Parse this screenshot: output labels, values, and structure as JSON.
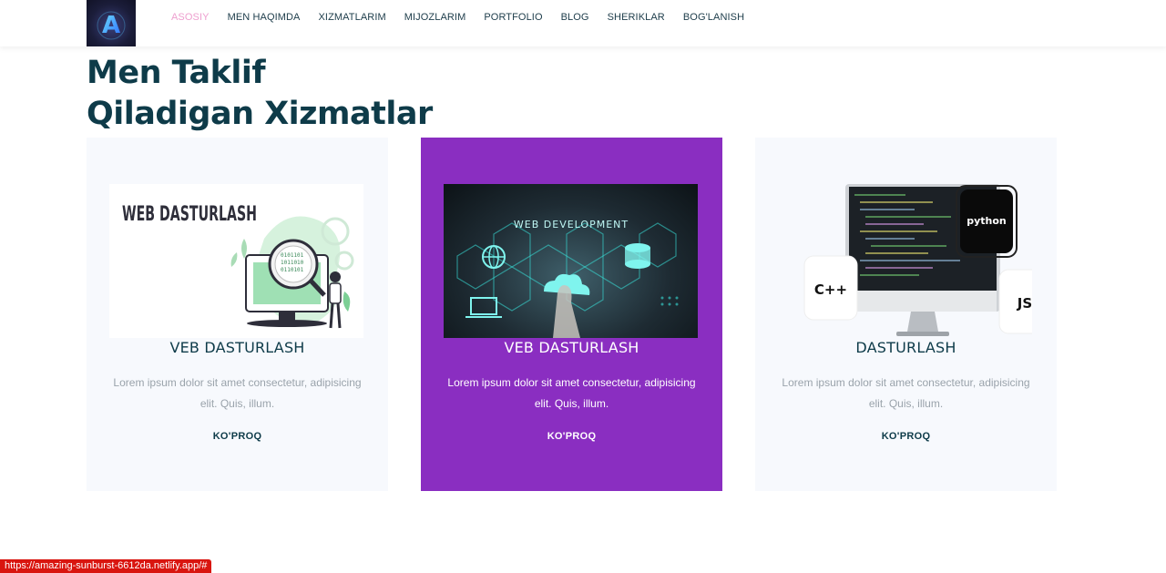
{
  "nav": {
    "logo_letter": "A",
    "links": [
      "ASOSIY",
      "MEN HAQIMDA",
      "XIZMATLARIM",
      "MIJOZLARIM",
      "PORTFOLIO",
      "BLOG",
      "SHERIKLAR",
      "BOG'LANISH"
    ],
    "active_link": "ASOSIY"
  },
  "section": {
    "title_line1": "Men Taklif",
    "title_line2": "Qiladigan Xizmatlar"
  },
  "cards": [
    {
      "title": "VEB DASTURLASH",
      "image_text": "WEB DASTURLASH",
      "description": "Lorem ipsum dolor sit amet consectetur, adipisicing elit. Quis, illum.",
      "link": "KO'PROQ"
    },
    {
      "title": "VEB DASTURLASH",
      "image_text": "WEB DEVELOPMENT",
      "description": "Lorem ipsum dolor sit amet consectetur, adipisicing elit. Quis, illum.",
      "link": "KO'PROQ"
    },
    {
      "title": "DASTURLASH",
      "image_labels": {
        "lang1": "C++",
        "lang2": "python",
        "lang3": "JS"
      },
      "description": "Lorem ipsum dolor sit amet consectetur, adipisicing elit. Quis, illum.",
      "link": "KO'PROQ"
    }
  ],
  "status_url": "https://amazing-sunburst-6612da.netlify.app/#",
  "colors": {
    "heading": "#0e3b49",
    "active_nav": "#ee9fcf",
    "highlight_card": "#8a2ec1",
    "card_bg": "#f7f9fd",
    "status_bar": "#d9150f"
  }
}
